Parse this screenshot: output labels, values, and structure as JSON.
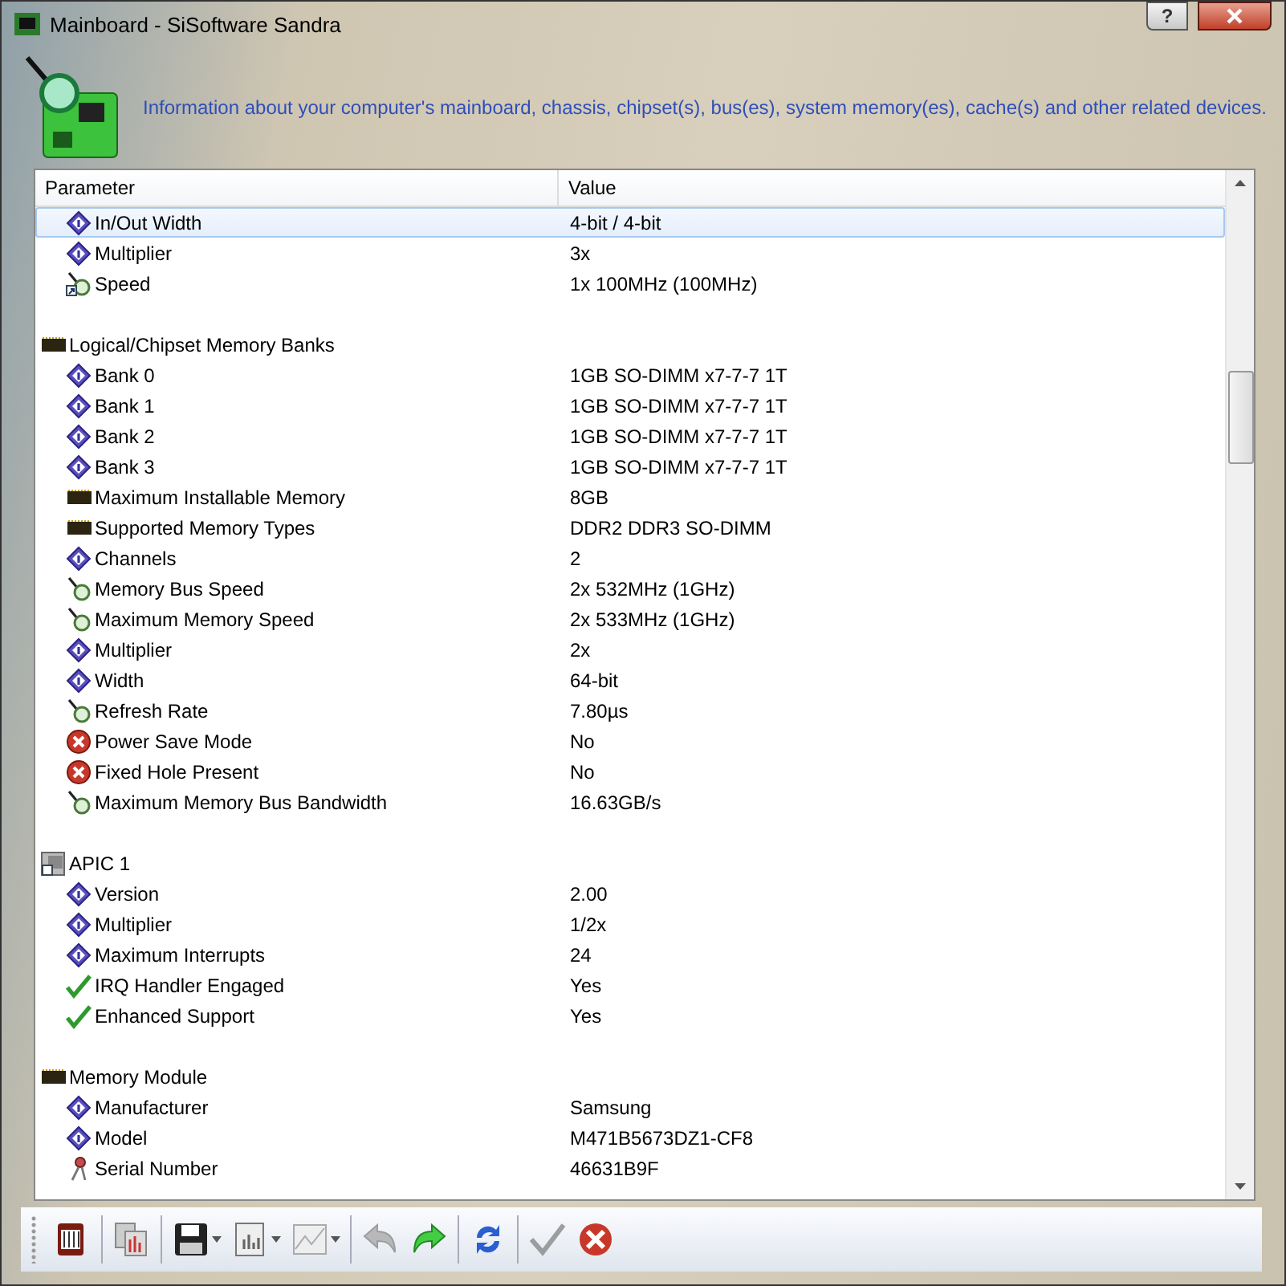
{
  "window": {
    "title": "Mainboard - SiSoftware Sandra",
    "help_button": "?"
  },
  "header": {
    "description": "Information about your computer's mainboard, chassis, chipset(s), bus(es), system memory(es), cache(s) and other related devices."
  },
  "table": {
    "columns": [
      "Parameter",
      "Value"
    ],
    "groups": [
      {
        "children": [
          {
            "kind": "info",
            "label": "In/Out Width",
            "value": "4-bit / 4-bit",
            "selected": true
          },
          {
            "kind": "info",
            "label": "Multiplier",
            "value": "3x",
            "selected": false
          },
          {
            "kind": "speed-link",
            "label": "Speed",
            "value": "1x 100MHz (100MHz)",
            "selected": false
          }
        ]
      },
      {
        "kind": "memory",
        "label": "Logical/Chipset Memory Banks",
        "children": [
          {
            "kind": "info",
            "label": "Bank 0",
            "value": "1GB SO-DIMM x7-7-7 1T",
            "selected": false
          },
          {
            "kind": "info",
            "label": "Bank 1",
            "value": "1GB SO-DIMM x7-7-7 1T",
            "selected": false
          },
          {
            "kind": "info",
            "label": "Bank 2",
            "value": "1GB SO-DIMM x7-7-7 1T",
            "selected": false
          },
          {
            "kind": "info",
            "label": "Bank 3",
            "value": "1GB SO-DIMM x7-7-7 1T",
            "selected": false
          },
          {
            "kind": "memory",
            "label": "Maximum Installable Memory",
            "value": "8GB",
            "selected": false
          },
          {
            "kind": "memory",
            "label": "Supported Memory Types",
            "value": "DDR2 DDR3 SO-DIMM",
            "selected": false
          },
          {
            "kind": "info",
            "label": "Channels",
            "value": "2",
            "selected": false
          },
          {
            "kind": "speed",
            "label": "Memory Bus Speed",
            "value": "2x 532MHz (1GHz)",
            "selected": false
          },
          {
            "kind": "speed",
            "label": "Maximum Memory Speed",
            "value": "2x 533MHz (1GHz)",
            "selected": false
          },
          {
            "kind": "info",
            "label": "Multiplier",
            "value": "2x",
            "selected": false
          },
          {
            "kind": "info",
            "label": "Width",
            "value": "64-bit",
            "selected": false
          },
          {
            "kind": "speed",
            "label": "Refresh Rate",
            "value": "7.80µs",
            "selected": false
          },
          {
            "kind": "no",
            "label": "Power Save Mode",
            "value": "No",
            "selected": false
          },
          {
            "kind": "no",
            "label": "Fixed Hole Present",
            "value": "No",
            "selected": false
          },
          {
            "kind": "speed",
            "label": "Maximum Memory Bus Bandwidth",
            "value": "16.63GB/s",
            "selected": false
          }
        ]
      },
      {
        "kind": "apic",
        "label": "APIC 1",
        "children": [
          {
            "kind": "info",
            "label": "Version",
            "value": "2.00",
            "selected": false
          },
          {
            "kind": "info",
            "label": "Multiplier",
            "value": "1/2x",
            "selected": false
          },
          {
            "kind": "info",
            "label": "Maximum Interrupts",
            "value": "24",
            "selected": false
          },
          {
            "kind": "yes",
            "label": "IRQ Handler Engaged",
            "value": "Yes",
            "selected": false
          },
          {
            "kind": "yes",
            "label": "Enhanced Support",
            "value": "Yes",
            "selected": false
          }
        ]
      },
      {
        "kind": "memory",
        "label": "Memory Module",
        "children": [
          {
            "kind": "info",
            "label": "Manufacturer",
            "value": "Samsung",
            "selected": false
          },
          {
            "kind": "info",
            "label": "Model",
            "value": "M471B5673DZ1-CF8",
            "selected": false
          },
          {
            "kind": "serial",
            "label": "Serial Number",
            "value": "46631B9F",
            "selected": false
          }
        ]
      }
    ]
  },
  "toolbar": [
    [
      {
        "kind": "module",
        "disabled": false
      }
    ],
    [
      {
        "kind": "compare",
        "disabled": false
      }
    ],
    [
      {
        "kind": "save",
        "disabled": false,
        "dropdown": true
      },
      {
        "kind": "report",
        "disabled": false,
        "dropdown": true
      },
      {
        "kind": "chart",
        "disabled": true,
        "dropdown": true
      }
    ],
    [
      {
        "kind": "back",
        "disabled": true,
        "dropdown": false
      },
      {
        "kind": "forward",
        "disabled": false,
        "dropdown": false
      }
    ],
    [
      {
        "kind": "refresh",
        "disabled": false,
        "dropdown": false
      }
    ],
    [
      {
        "kind": "ok",
        "disabled": true,
        "dropdown": false
      },
      {
        "kind": "cancel",
        "disabled": false,
        "dropdown": false
      }
    ]
  ]
}
